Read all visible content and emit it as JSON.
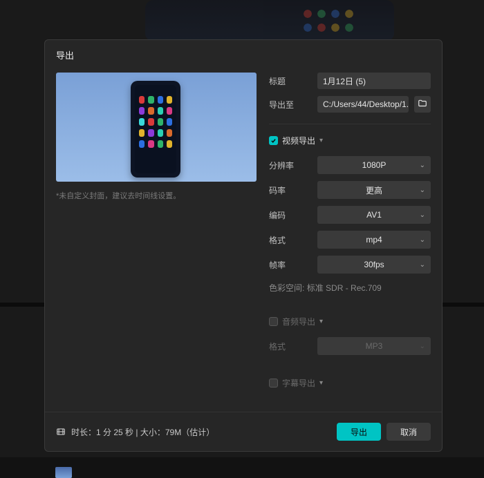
{
  "modal_title": "导出",
  "preview_hint": "*未自定义封面，建议去时间线设置。",
  "fields": {
    "title_label": "标题",
    "title_value": "1月12日 (5)",
    "export_to_label": "导出至",
    "export_to_value": "C:/Users/44/Desktop/1..."
  },
  "video": {
    "section_title": "视频导出",
    "enabled": true,
    "resolution_label": "分辨率",
    "resolution_value": "1080P",
    "bitrate_label": "码率",
    "bitrate_value": "更高",
    "codec_label": "编码",
    "codec_value": "AV1",
    "format_label": "格式",
    "format_value": "mp4",
    "fps_label": "帧率",
    "fps_value": "30fps",
    "colorspace_label": "色彩空间:",
    "colorspace_value": "标准 SDR - Rec.709"
  },
  "audio": {
    "section_title": "音频导出",
    "enabled": false,
    "format_label": "格式",
    "format_value": "MP3"
  },
  "subtitle": {
    "section_title": "字幕导出",
    "enabled": false
  },
  "footer": {
    "duration_label": "时长：",
    "duration_value": "1 分 25 秒",
    "size_label": "大小：",
    "size_value": "79M（估计）",
    "separator": " | ",
    "export_btn": "导出",
    "cancel_btn": "取消"
  },
  "icon_colors": [
    "#d93a3a",
    "#2fb36a",
    "#2c6fe0",
    "#e0b32c",
    "#8c3ad9",
    "#d96a2c",
    "#2cd0b3",
    "#d93a84",
    "#3ad9d9",
    "#d93a3a",
    "#2fb36a",
    "#2c6fe0",
    "#e0b32c",
    "#8c3ad9",
    "#2cd0b3",
    "#d96a2c",
    "#2c6fe0",
    "#d93a84",
    "#2fb36a",
    "#e0b32c"
  ]
}
